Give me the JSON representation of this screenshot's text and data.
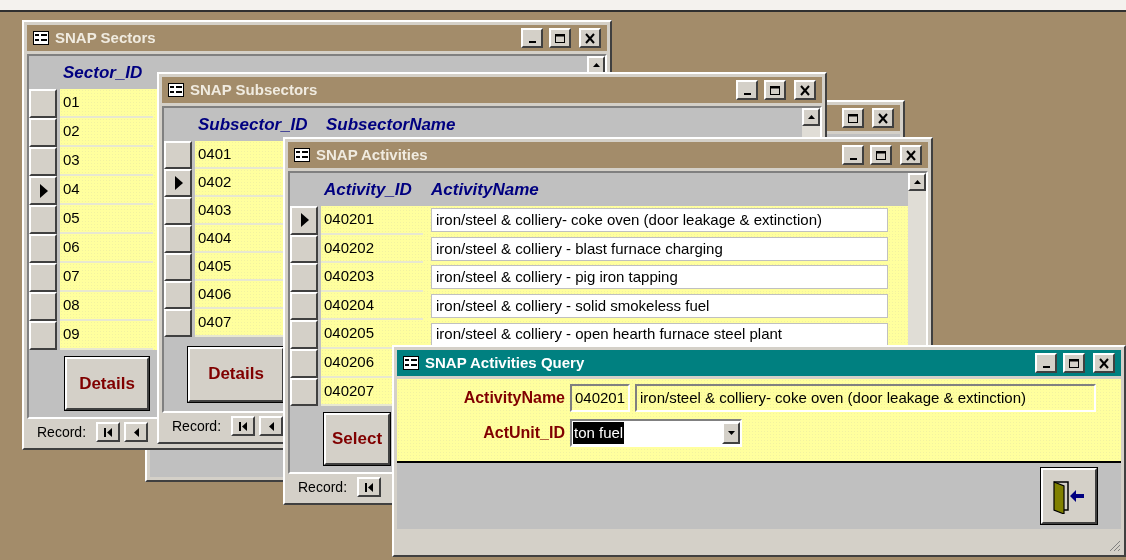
{
  "windows": [
    {
      "kind": "blank",
      "active": false
    },
    {
      "kind": "datasheet",
      "title": "SNAP Sectors",
      "active": false,
      "columns": [
        "Sector_ID"
      ],
      "rows": [
        {
          "code": "01",
          "selected": false
        },
        {
          "code": "02",
          "selected": false
        },
        {
          "code": "03",
          "selected": false
        },
        {
          "code": "04",
          "selected": true
        },
        {
          "code": "05",
          "selected": false
        },
        {
          "code": "06",
          "selected": false
        },
        {
          "code": "07",
          "selected": false
        },
        {
          "code": "08",
          "selected": false
        },
        {
          "code": "09",
          "selected": false
        }
      ],
      "button": "Details",
      "record_label": "Record:"
    },
    {
      "kind": "datasheet",
      "title": "SNAP Subsectors",
      "active": false,
      "columns": [
        "Subsector_ID",
        "SubsectorName"
      ],
      "rows": [
        {
          "code": "0401",
          "selected": false
        },
        {
          "code": "0402",
          "selected": true
        },
        {
          "code": "0403",
          "selected": false
        },
        {
          "code": "0404",
          "selected": false
        },
        {
          "code": "0405",
          "selected": false
        },
        {
          "code": "0406",
          "selected": false
        },
        {
          "code": "0407",
          "selected": false
        }
      ],
      "button": "Details",
      "record_label": "Record:"
    },
    {
      "kind": "datasheet",
      "title": "SNAP Activities",
      "active": false,
      "columns": [
        "Activity_ID",
        "ActivityName"
      ],
      "rows": [
        {
          "code": "040201",
          "name": "iron/steel & colliery- coke oven (door leakage & extinction)",
          "selected": true
        },
        {
          "code": "040202",
          "name": "iron/steel & colliery - blast furnace charging",
          "selected": false
        },
        {
          "code": "040203",
          "name": "iron/steel & colliery - pig iron tapping",
          "selected": false
        },
        {
          "code": "040204",
          "name": "iron/steel & colliery - solid smokeless fuel",
          "selected": false
        },
        {
          "code": "040205",
          "name": "iron/steel & colliery - open hearth furnace steel plant",
          "selected": false
        },
        {
          "code": "040206",
          "selected": false
        },
        {
          "code": "040207",
          "selected": false
        }
      ],
      "button": "Select",
      "record_label": "Record:"
    },
    {
      "kind": "form",
      "title": "SNAP Activities Query",
      "active": true,
      "fields": [
        {
          "kind": "text",
          "label": "ActivityName",
          "values": [
            "040201",
            "iron/steel & colliery- coke oven (door leakage & extinction)"
          ]
        },
        {
          "kind": "combo",
          "label": "ActUnit_ID",
          "value": "ton fuel",
          "text_selected": true
        }
      ]
    }
  ]
}
